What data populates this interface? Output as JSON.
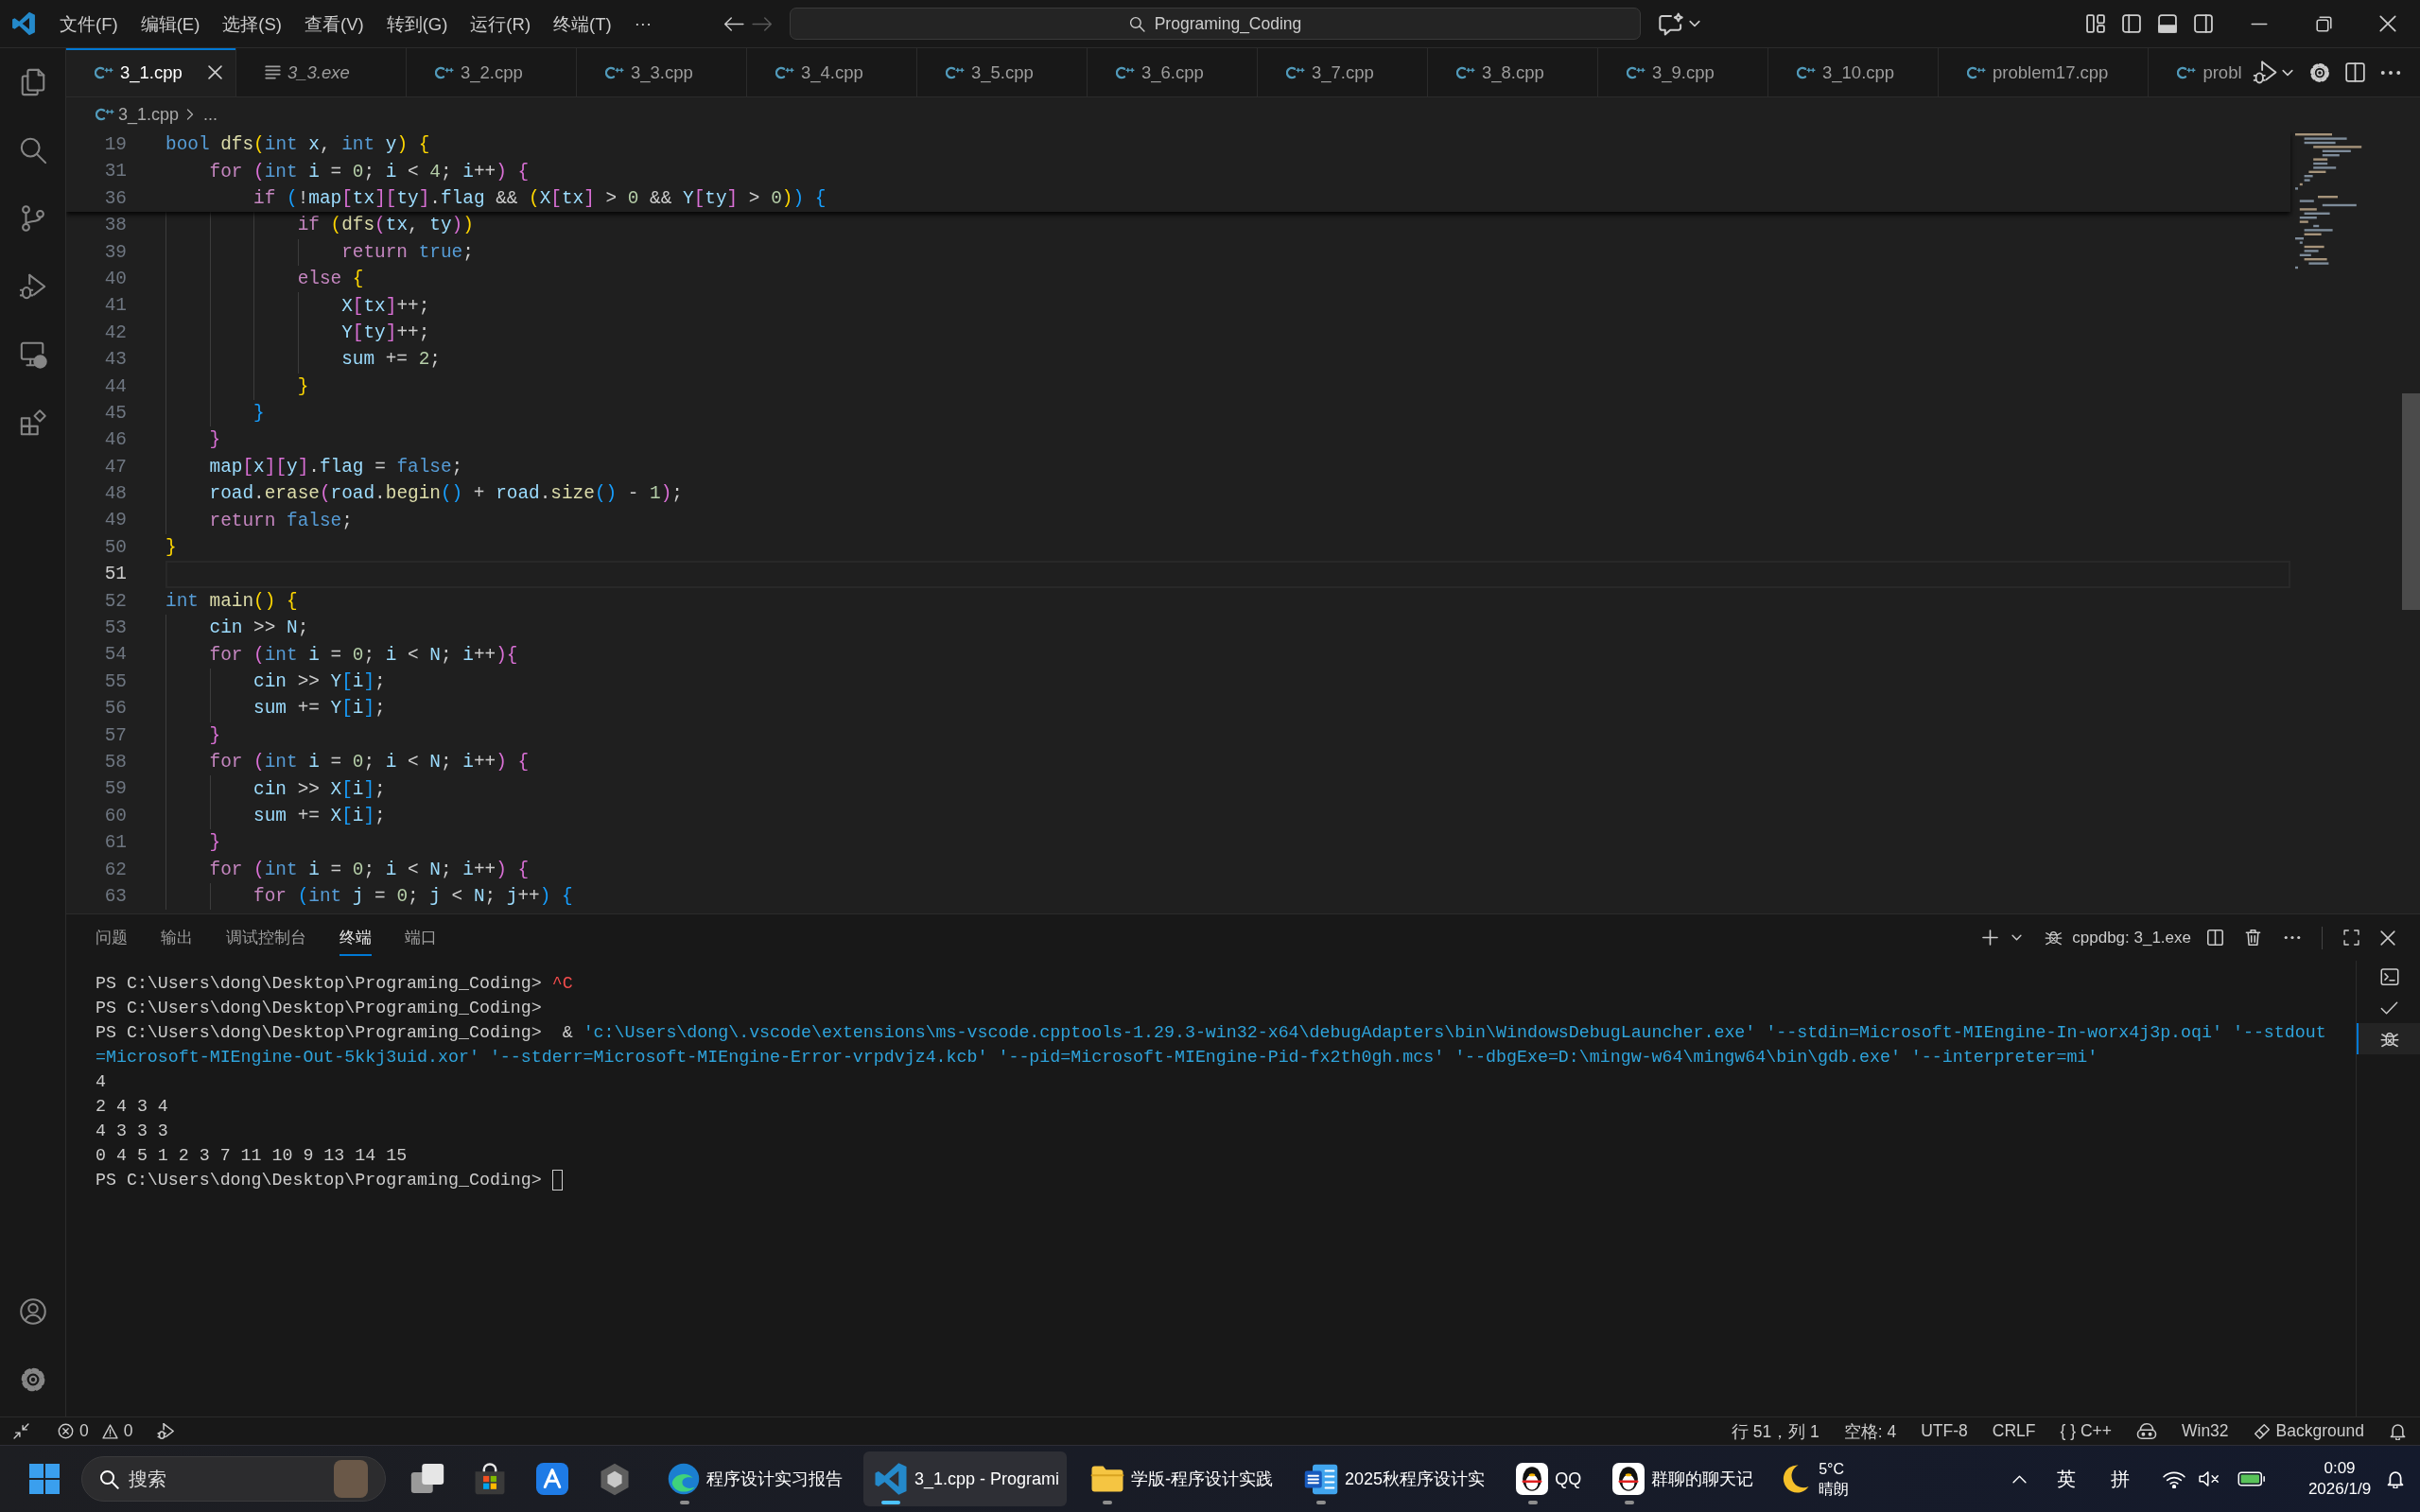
{
  "title_bar": {
    "menu": [
      "文件(F)",
      "编辑(E)",
      "选择(S)",
      "查看(V)",
      "转到(G)",
      "运行(R)",
      "终端(T)"
    ],
    "more": "···",
    "navigation": [
      {
        "kind": "back",
        "disabled": false
      },
      {
        "kind": "forward",
        "disabled": true
      }
    ],
    "command_center": "Programing_Coding"
  },
  "tabs": [
    {
      "label": "3_1.cpp",
      "kind": "cpp",
      "selected": true,
      "preview": false
    },
    {
      "label": "3_3.exe",
      "kind": "binary",
      "selected": false,
      "preview": true
    },
    {
      "label": "3_2.cpp",
      "kind": "cpp",
      "selected": false,
      "preview": false
    },
    {
      "label": "3_3.cpp",
      "kind": "cpp",
      "selected": false,
      "preview": false
    },
    {
      "label": "3_4.cpp",
      "kind": "cpp",
      "selected": false,
      "preview": false
    },
    {
      "label": "3_5.cpp",
      "kind": "cpp",
      "selected": false,
      "preview": false
    },
    {
      "label": "3_6.cpp",
      "kind": "cpp",
      "selected": false,
      "preview": false
    },
    {
      "label": "3_7.cpp",
      "kind": "cpp",
      "selected": false,
      "preview": false
    },
    {
      "label": "3_8.cpp",
      "kind": "cpp",
      "selected": false,
      "preview": false
    },
    {
      "label": "3_9.cpp",
      "kind": "cpp",
      "selected": false,
      "preview": false
    },
    {
      "label": "3_10.cpp",
      "kind": "cpp",
      "selected": false,
      "preview": false
    },
    {
      "label": "problem17.cpp",
      "kind": "cpp",
      "selected": false,
      "preview": false
    },
    {
      "label": "probl",
      "kind": "cpp",
      "selected": false,
      "preview": false
    }
  ],
  "breadcrumb": {
    "kind": "cpp",
    "file": "3_1.cpp",
    "trail": "..."
  },
  "editor": {
    "sticky_lines": [
      {
        "number": "19",
        "tokens": [
          {
            "kind": "keyword",
            "text": "bool "
          },
          {
            "kind": "function",
            "text": "dfs"
          },
          {
            "kind": "bracket1",
            "text": "("
          },
          {
            "kind": "keyword",
            "text": "int "
          },
          {
            "kind": "variable",
            "text": "x"
          },
          {
            "kind": "operator",
            "text": ", "
          },
          {
            "kind": "keyword",
            "text": "int "
          },
          {
            "kind": "variable",
            "text": "y"
          },
          {
            "kind": "bracket1",
            "text": ")"
          },
          {
            "kind": "bracket1",
            "text": " {"
          }
        ]
      },
      {
        "number": "31",
        "tokens": [
          {
            "kind": "control",
            "text": "    for "
          },
          {
            "kind": "bracket2",
            "text": "("
          },
          {
            "kind": "keyword",
            "text": "int "
          },
          {
            "kind": "variable",
            "text": "i"
          },
          {
            "kind": "operator",
            "text": " = "
          },
          {
            "kind": "number",
            "text": "0"
          },
          {
            "kind": "operator",
            "text": "; "
          },
          {
            "kind": "variable",
            "text": "i"
          },
          {
            "kind": "operator",
            "text": " < "
          },
          {
            "kind": "number",
            "text": "4"
          },
          {
            "kind": "operator",
            "text": "; "
          },
          {
            "kind": "variable",
            "text": "i"
          },
          {
            "kind": "operator",
            "text": "++"
          },
          {
            "kind": "bracket2",
            "text": ")"
          },
          {
            "kind": "bracket2",
            "text": " {"
          }
        ]
      },
      {
        "number": "36",
        "tokens": [
          {
            "kind": "control",
            "text": "        if "
          },
          {
            "kind": "bracket3",
            "text": "("
          },
          {
            "kind": "operator",
            "text": "!"
          },
          {
            "kind": "variable",
            "text": "map"
          },
          {
            "kind": "bracket2",
            "text": "["
          },
          {
            "kind": "variable",
            "text": "tx"
          },
          {
            "kind": "bracket2",
            "text": "]["
          },
          {
            "kind": "variable",
            "text": "ty"
          },
          {
            "kind": "bracket2",
            "text": "]"
          },
          {
            "kind": "operator",
            "text": "."
          },
          {
            "kind": "variable",
            "text": "flag"
          },
          {
            "kind": "operator",
            "text": " && "
          },
          {
            "kind": "bracket1",
            "text": "("
          },
          {
            "kind": "variable",
            "text": "X"
          },
          {
            "kind": "bracket2",
            "text": "["
          },
          {
            "kind": "variable",
            "text": "tx"
          },
          {
            "kind": "bracket2",
            "text": "]"
          },
          {
            "kind": "operator",
            "text": " > "
          },
          {
            "kind": "number",
            "text": "0"
          },
          {
            "kind": "operator",
            "text": " && "
          },
          {
            "kind": "variable",
            "text": "Y"
          },
          {
            "kind": "bracket2",
            "text": "["
          },
          {
            "kind": "variable",
            "text": "ty"
          },
          {
            "kind": "bracket2",
            "text": "]"
          },
          {
            "kind": "operator",
            "text": " > "
          },
          {
            "kind": "number",
            "text": "0"
          },
          {
            "kind": "bracket1",
            "text": ")"
          },
          {
            "kind": "bracket3",
            "text": ")"
          },
          {
            "kind": "bracket3",
            "text": " {"
          }
        ]
      }
    ],
    "lines": [
      {
        "number": "38",
        "current": false,
        "tokens": [
          {
            "kind": "control",
            "text": "            if "
          },
          {
            "kind": "bracket1",
            "text": "("
          },
          {
            "kind": "function",
            "text": "dfs"
          },
          {
            "kind": "bracket2",
            "text": "("
          },
          {
            "kind": "variable",
            "text": "tx"
          },
          {
            "kind": "operator",
            "text": ", "
          },
          {
            "kind": "variable",
            "text": "ty"
          },
          {
            "kind": "bracket2",
            "text": ")"
          },
          {
            "kind": "bracket1",
            "text": ")"
          }
        ]
      },
      {
        "number": "39",
        "current": false,
        "tokens": [
          {
            "kind": "control",
            "text": "                return "
          },
          {
            "kind": "keyword",
            "text": "true"
          },
          {
            "kind": "operator",
            "text": ";"
          }
        ]
      },
      {
        "number": "40",
        "current": false,
        "tokens": [
          {
            "kind": "control",
            "text": "            else "
          },
          {
            "kind": "bracket1",
            "text": "{"
          }
        ]
      },
      {
        "number": "41",
        "current": false,
        "tokens": [
          {
            "kind": "variable",
            "text": "                X"
          },
          {
            "kind": "bracket2",
            "text": "["
          },
          {
            "kind": "variable",
            "text": "tx"
          },
          {
            "kind": "bracket2",
            "text": "]"
          },
          {
            "kind": "operator",
            "text": "++;"
          }
        ]
      },
      {
        "number": "42",
        "current": false,
        "tokens": [
          {
            "kind": "variable",
            "text": "                Y"
          },
          {
            "kind": "bracket2",
            "text": "["
          },
          {
            "kind": "variable",
            "text": "ty"
          },
          {
            "kind": "bracket2",
            "text": "]"
          },
          {
            "kind": "operator",
            "text": "++;"
          }
        ]
      },
      {
        "number": "43",
        "current": false,
        "tokens": [
          {
            "kind": "variable",
            "text": "                sum"
          },
          {
            "kind": "operator",
            "text": " += "
          },
          {
            "kind": "number",
            "text": "2"
          },
          {
            "kind": "operator",
            "text": ";"
          }
        ]
      },
      {
        "number": "44",
        "current": false,
        "tokens": [
          {
            "kind": "bracket1",
            "text": "            }"
          }
        ]
      },
      {
        "number": "45",
        "current": false,
        "tokens": [
          {
            "kind": "bracket3",
            "text": "        }"
          }
        ]
      },
      {
        "number": "46",
        "current": false,
        "tokens": [
          {
            "kind": "bracket2",
            "text": "    }"
          }
        ]
      },
      {
        "number": "47",
        "current": false,
        "tokens": [
          {
            "kind": "variable",
            "text": "    map"
          },
          {
            "kind": "bracket2",
            "text": "["
          },
          {
            "kind": "variable",
            "text": "x"
          },
          {
            "kind": "bracket2",
            "text": "]["
          },
          {
            "kind": "variable",
            "text": "y"
          },
          {
            "kind": "bracket2",
            "text": "]"
          },
          {
            "kind": "operator",
            "text": "."
          },
          {
            "kind": "variable",
            "text": "flag"
          },
          {
            "kind": "operator",
            "text": " = "
          },
          {
            "kind": "keyword",
            "text": "false"
          },
          {
            "kind": "operator",
            "text": ";"
          }
        ]
      },
      {
        "number": "48",
        "current": false,
        "tokens": [
          {
            "kind": "variable",
            "text": "    road"
          },
          {
            "kind": "operator",
            "text": "."
          },
          {
            "kind": "function",
            "text": "erase"
          },
          {
            "kind": "bracket2",
            "text": "("
          },
          {
            "kind": "variable",
            "text": "road"
          },
          {
            "kind": "operator",
            "text": "."
          },
          {
            "kind": "function",
            "text": "begin"
          },
          {
            "kind": "bracket3",
            "text": "()"
          },
          {
            "kind": "operator",
            "text": " + "
          },
          {
            "kind": "variable",
            "text": "road"
          },
          {
            "kind": "operator",
            "text": "."
          },
          {
            "kind": "function",
            "text": "size"
          },
          {
            "kind": "bracket3",
            "text": "()"
          },
          {
            "kind": "operator",
            "text": " - "
          },
          {
            "kind": "number",
            "text": "1"
          },
          {
            "kind": "bracket2",
            "text": ")"
          },
          {
            "kind": "operator",
            "text": ";"
          }
        ]
      },
      {
        "number": "49",
        "current": false,
        "tokens": [
          {
            "kind": "control",
            "text": "    return "
          },
          {
            "kind": "keyword",
            "text": "false"
          },
          {
            "kind": "operator",
            "text": ";"
          }
        ]
      },
      {
        "number": "50",
        "current": false,
        "tokens": [
          {
            "kind": "bracket1",
            "text": "}"
          }
        ]
      },
      {
        "number": "51",
        "current": true
      },
      {
        "number": "52",
        "current": false,
        "tokens": [
          {
            "kind": "keyword",
            "text": "int "
          },
          {
            "kind": "function",
            "text": "main"
          },
          {
            "kind": "bracket1",
            "text": "()"
          },
          {
            "kind": "bracket1",
            "text": " {"
          }
        ]
      },
      {
        "number": "53",
        "current": false,
        "tokens": [
          {
            "kind": "variable",
            "text": "    cin"
          },
          {
            "kind": "operator",
            "text": " >> "
          },
          {
            "kind": "variable",
            "text": "N"
          },
          {
            "kind": "operator",
            "text": ";"
          }
        ]
      },
      {
        "number": "54",
        "current": false,
        "tokens": [
          {
            "kind": "control",
            "text": "    for "
          },
          {
            "kind": "bracket2",
            "text": "("
          },
          {
            "kind": "keyword",
            "text": "int "
          },
          {
            "kind": "variable",
            "text": "i"
          },
          {
            "kind": "operator",
            "text": " = "
          },
          {
            "kind": "number",
            "text": "0"
          },
          {
            "kind": "operator",
            "text": "; "
          },
          {
            "kind": "variable",
            "text": "i"
          },
          {
            "kind": "operator",
            "text": " < "
          },
          {
            "kind": "variable",
            "text": "N"
          },
          {
            "kind": "operator",
            "text": "; "
          },
          {
            "kind": "variable",
            "text": "i"
          },
          {
            "kind": "operator",
            "text": "++"
          },
          {
            "kind": "bracket2",
            "text": "){"
          }
        ]
      },
      {
        "number": "55",
        "current": false,
        "tokens": [
          {
            "kind": "variable",
            "text": "        cin"
          },
          {
            "kind": "operator",
            "text": " >> "
          },
          {
            "kind": "variable",
            "text": "Y"
          },
          {
            "kind": "bracket3",
            "text": "["
          },
          {
            "kind": "variable",
            "text": "i"
          },
          {
            "kind": "bracket3",
            "text": "]"
          },
          {
            "kind": "operator",
            "text": ";"
          }
        ]
      },
      {
        "number": "56",
        "current": false,
        "tokens": [
          {
            "kind": "variable",
            "text": "        sum"
          },
          {
            "kind": "operator",
            "text": " += "
          },
          {
            "kind": "variable",
            "text": "Y"
          },
          {
            "kind": "bracket3",
            "text": "["
          },
          {
            "kind": "variable",
            "text": "i"
          },
          {
            "kind": "bracket3",
            "text": "]"
          },
          {
            "kind": "operator",
            "text": ";"
          }
        ]
      },
      {
        "number": "57",
        "current": false,
        "tokens": [
          {
            "kind": "bracket2",
            "text": "    }"
          }
        ]
      },
      {
        "number": "58",
        "current": false,
        "tokens": [
          {
            "kind": "control",
            "text": "    for "
          },
          {
            "kind": "bracket2",
            "text": "("
          },
          {
            "kind": "keyword",
            "text": "int "
          },
          {
            "kind": "variable",
            "text": "i"
          },
          {
            "kind": "operator",
            "text": " = "
          },
          {
            "kind": "number",
            "text": "0"
          },
          {
            "kind": "operator",
            "text": "; "
          },
          {
            "kind": "variable",
            "text": "i"
          },
          {
            "kind": "operator",
            "text": " < "
          },
          {
            "kind": "variable",
            "text": "N"
          },
          {
            "kind": "operator",
            "text": "; "
          },
          {
            "kind": "variable",
            "text": "i"
          },
          {
            "kind": "operator",
            "text": "++"
          },
          {
            "kind": "bracket2",
            "text": ")"
          },
          {
            "kind": "bracket2",
            "text": " {"
          }
        ]
      },
      {
        "number": "59",
        "current": false,
        "tokens": [
          {
            "kind": "variable",
            "text": "        cin"
          },
          {
            "kind": "operator",
            "text": " >> "
          },
          {
            "kind": "variable",
            "text": "X"
          },
          {
            "kind": "bracket3",
            "text": "["
          },
          {
            "kind": "variable",
            "text": "i"
          },
          {
            "kind": "bracket3",
            "text": "]"
          },
          {
            "kind": "operator",
            "text": ";"
          }
        ]
      },
      {
        "number": "60",
        "current": false,
        "tokens": [
          {
            "kind": "variable",
            "text": "        sum"
          },
          {
            "kind": "operator",
            "text": " += "
          },
          {
            "kind": "variable",
            "text": "X"
          },
          {
            "kind": "bracket3",
            "text": "["
          },
          {
            "kind": "variable",
            "text": "i"
          },
          {
            "kind": "bracket3",
            "text": "]"
          },
          {
            "kind": "operator",
            "text": ";"
          }
        ]
      },
      {
        "number": "61",
        "current": false,
        "tokens": [
          {
            "kind": "bracket2",
            "text": "    }"
          }
        ]
      },
      {
        "number": "62",
        "current": false,
        "tokens": [
          {
            "kind": "control",
            "text": "    for "
          },
          {
            "kind": "bracket2",
            "text": "("
          },
          {
            "kind": "keyword",
            "text": "int "
          },
          {
            "kind": "variable",
            "text": "i"
          },
          {
            "kind": "operator",
            "text": " = "
          },
          {
            "kind": "number",
            "text": "0"
          },
          {
            "kind": "operator",
            "text": "; "
          },
          {
            "kind": "variable",
            "text": "i"
          },
          {
            "kind": "operator",
            "text": " < "
          },
          {
            "kind": "variable",
            "text": "N"
          },
          {
            "kind": "operator",
            "text": "; "
          },
          {
            "kind": "variable",
            "text": "i"
          },
          {
            "kind": "operator",
            "text": "++"
          },
          {
            "kind": "bracket2",
            "text": ")"
          },
          {
            "kind": "bracket2",
            "text": " {"
          }
        ]
      },
      {
        "number": "63",
        "current": false,
        "tokens": [
          {
            "kind": "control",
            "text": "        for "
          },
          {
            "kind": "bracket3",
            "text": "("
          },
          {
            "kind": "keyword",
            "text": "int "
          },
          {
            "kind": "variable",
            "text": "j"
          },
          {
            "kind": "operator",
            "text": " = "
          },
          {
            "kind": "number",
            "text": "0"
          },
          {
            "kind": "operator",
            "text": "; "
          },
          {
            "kind": "variable",
            "text": "j"
          },
          {
            "kind": "operator",
            "text": " < "
          },
          {
            "kind": "variable",
            "text": "N"
          },
          {
            "kind": "operator",
            "text": "; "
          },
          {
            "kind": "variable",
            "text": "j"
          },
          {
            "kind": "operator",
            "text": "++"
          },
          {
            "kind": "bracket3",
            "text": ")"
          },
          {
            "kind": "bracket3",
            "text": " {"
          }
        ]
      }
    ]
  },
  "panel": {
    "tabs": [
      {
        "label": "问题",
        "selected": false
      },
      {
        "label": "输出",
        "selected": false
      },
      {
        "label": "调试控制台",
        "selected": false
      },
      {
        "label": "终端",
        "selected": true
      },
      {
        "label": "端口",
        "selected": false
      }
    ],
    "terminal_name": "cppdbg: 3_1.exe",
    "terminal_lines": [
      {
        "cursor": false,
        "segments": [
          {
            "kind": "text",
            "text": "PS C:\\Users\\dong\\Desktop\\Programing_Coding> "
          },
          {
            "kind": "error",
            "text": "^C"
          }
        ]
      },
      {
        "cursor": false,
        "segments": [
          {
            "kind": "text",
            "text": "PS C:\\Users\\dong\\Desktop\\Programing_Coding>"
          }
        ]
      },
      {
        "cursor": false,
        "segments": [
          {
            "kind": "text",
            "text": "PS C:\\Users\\dong\\Desktop\\Programing_Coding>  & "
          },
          {
            "kind": "string",
            "text": "'c:\\Users\\dong\\.vscode\\extensions\\ms-vscode.cpptools-1.29.3-win32-x64\\debugAdapters\\bin\\WindowsDebugLauncher.exe' '--stdin=Microsoft-MIEngine-In-worx4j3p.oqi' '--stdout"
          }
        ]
      },
      {
        "cursor": false,
        "segments": [
          {
            "kind": "string",
            "text": "=Microsoft-MIEngine-Out-5kkj3uid.xor' '--stderr=Microsoft-MIEngine-Error-vrpdvjz4.kcb' '--pid=Microsoft-MIEngine-Pid-fx2th0gh.mcs' '--dbgExe=D:\\mingw-w64\\mingw64\\bin\\gdb.exe' '--interpreter=mi'"
          }
        ]
      },
      {
        "cursor": false,
        "segments": [
          {
            "kind": "text",
            "text": "4"
          }
        ]
      },
      {
        "cursor": false,
        "segments": [
          {
            "kind": "text",
            "text": "2 4 3 4"
          }
        ]
      },
      {
        "cursor": false,
        "segments": [
          {
            "kind": "text",
            "text": "4 3 3 3"
          }
        ]
      },
      {
        "cursor": false,
        "segments": [
          {
            "kind": "text",
            "text": "0 4 5 1 2 3 7 11 10 9 13 14 15"
          }
        ]
      },
      {
        "cursor": true,
        "segments": [
          {
            "kind": "text",
            "text": "PS C:\\Users\\dong\\Desktop\\Programing_Coding> "
          }
        ]
      }
    ],
    "terminals": [
      {
        "kind": "shell",
        "selected": false
      },
      {
        "kind": "task",
        "selected": false
      },
      {
        "kind": "debug",
        "selected": true
      }
    ]
  },
  "status_bar": {
    "errors": "0",
    "warnings": "0",
    "items": [
      {
        "kind": "text",
        "text": "行 51，列 1"
      },
      {
        "kind": "text",
        "text": "空格: 4"
      },
      {
        "kind": "text",
        "text": "UTF-8"
      },
      {
        "kind": "text",
        "text": "CRLF"
      },
      {
        "kind": "text",
        "text": "{ } C++"
      },
      {
        "kind": "assistant"
      },
      {
        "kind": "text",
        "text": "Win32"
      },
      {
        "kind": "tasks",
        "text": "Background"
      },
      {
        "kind": "notifications"
      }
    ]
  },
  "taskbar": {
    "search": {
      "placeholder": "搜索"
    },
    "pinned": [
      {
        "kind": "task_view"
      },
      {
        "kind": "store"
      },
      {
        "kind": "app_tile"
      },
      {
        "kind": "hexagon"
      }
    ],
    "apps": [
      {
        "kind": "browser",
        "label": "程序设计实习报告",
        "running": true,
        "selected": false
      },
      {
        "kind": "code",
        "label": "3_1.cpp - Programi",
        "running": true,
        "selected": true
      },
      {
        "kind": "folder",
        "label": "学版-程序设计实践",
        "running": true,
        "selected": false
      },
      {
        "kind": "document",
        "label": "2025秋程序设计实",
        "running": true,
        "selected": false
      },
      {
        "kind": "penguin",
        "label": "QQ",
        "running": true,
        "selected": false
      },
      {
        "kind": "penguin",
        "label": "群聊的聊天记",
        "running": true,
        "selected": false
      }
    ],
    "weather": {
      "temperature": "5°C",
      "condition": "晴朗"
    },
    "tray": {
      "language": "英",
      "input_mode": "拼"
    },
    "clock": {
      "time": "0:09",
      "date": "2026/1/9"
    }
  }
}
